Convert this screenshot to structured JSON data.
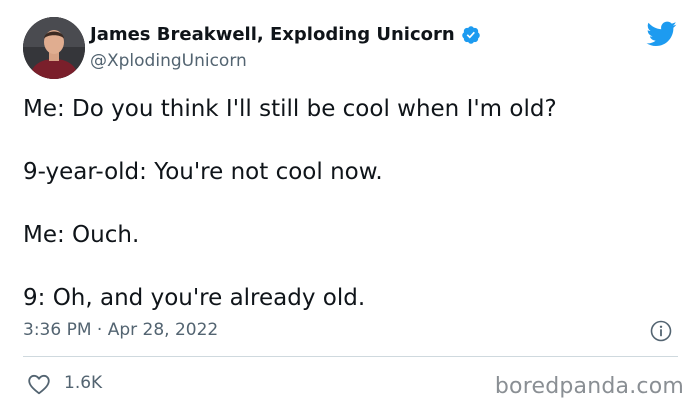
{
  "author": {
    "display_name": "James Breakwell, Exploding Unicorn",
    "handle": "@XplodingUnicorn",
    "verified": true,
    "avatar_icon": "profile-photo"
  },
  "tweet": {
    "lines": [
      "Me: Do you think I'll still be cool when I'm old?",
      "9-year-old: You're not cool now.",
      "Me: Ouch.",
      "9: Oh, and you're already old."
    ],
    "timestamp": "3:36 PM · Apr 28, 2022",
    "likes": "1.6K"
  },
  "watermark": "boredpanda.com",
  "colors": {
    "twitter_blue": "#1d9bf0",
    "text": "#0f1419",
    "secondary": "#536471",
    "divider": "#cfd9de"
  }
}
